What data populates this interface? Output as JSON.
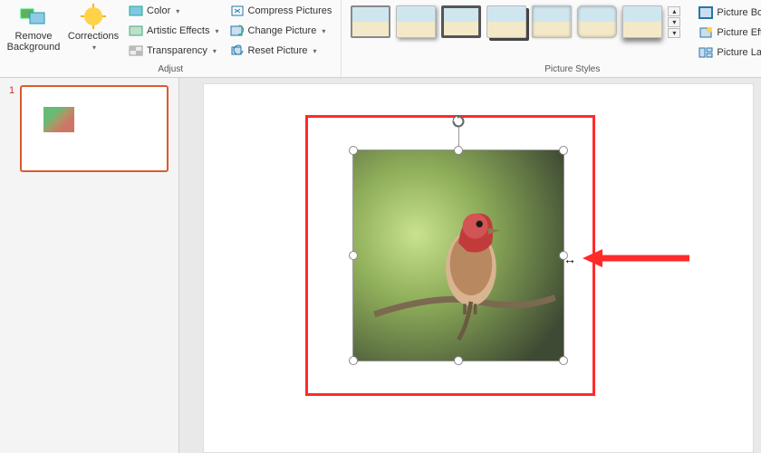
{
  "ribbon": {
    "adjust": {
      "label": "Adjust",
      "remove_bg": "Remove\nBackground",
      "corrections": "Corrections",
      "color": "Color",
      "artistic": "Artistic Effects",
      "transparency": "Transparency",
      "compress": "Compress Pictures",
      "change": "Change Picture",
      "reset": "Reset Picture"
    },
    "styles": {
      "label": "Picture Styles",
      "border": "Picture Border",
      "effects": "Picture Effects",
      "layout": "Picture Layout"
    }
  },
  "slides": {
    "current": "1"
  }
}
